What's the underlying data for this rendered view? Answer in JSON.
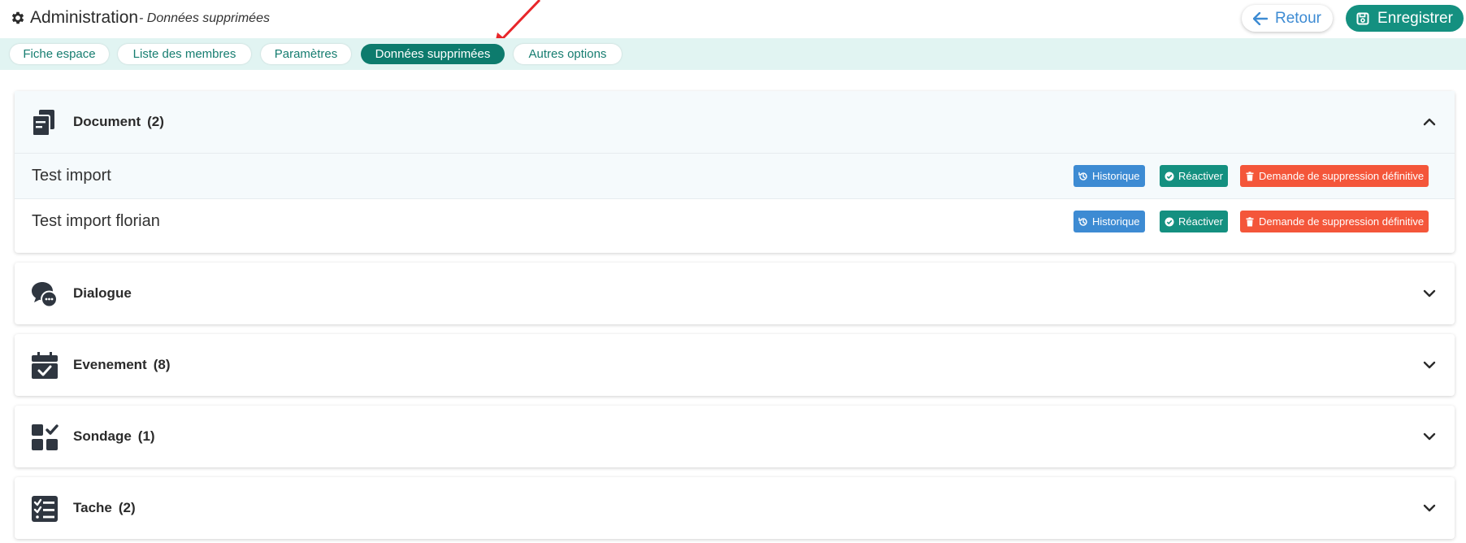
{
  "header": {
    "title": "Administration",
    "subtitle": "- Données supprimées",
    "back_label": "Retour",
    "save_label": "Enregistrer"
  },
  "tabs": [
    {
      "label": "Fiche espace",
      "active": false
    },
    {
      "label": "Liste des membres",
      "active": false
    },
    {
      "label": "Paramètres",
      "active": false
    },
    {
      "label": "Données supprimées",
      "active": true
    },
    {
      "label": "Autres options",
      "active": false
    }
  ],
  "row_actions": {
    "history": "Historique",
    "reactivate": "Réactiver",
    "delete": "Demande de suppression définitive"
  },
  "sections": [
    {
      "label": "Document",
      "count": "(2)",
      "icon": "documents-icon",
      "expanded": true,
      "items": [
        "Test import",
        "Test import florian"
      ]
    },
    {
      "label": "Dialogue",
      "count": "",
      "icon": "chat-bubbles-icon",
      "expanded": false,
      "items": []
    },
    {
      "label": "Evenement",
      "count": "(8)",
      "icon": "calendar-check-icon",
      "expanded": false,
      "items": []
    },
    {
      "label": "Sondage",
      "count": "(1)",
      "icon": "poll-grid-icon",
      "expanded": false,
      "items": []
    },
    {
      "label": "Tache",
      "count": "(2)",
      "icon": "task-list-icon",
      "expanded": false,
      "items": []
    }
  ],
  "colors": {
    "accent": "#149080",
    "tab_bar_bg": "#e1f4f2",
    "history_btn": "#3d8bd3",
    "delete_btn": "#f4563a",
    "annotation_arrow": "#e8262a"
  }
}
